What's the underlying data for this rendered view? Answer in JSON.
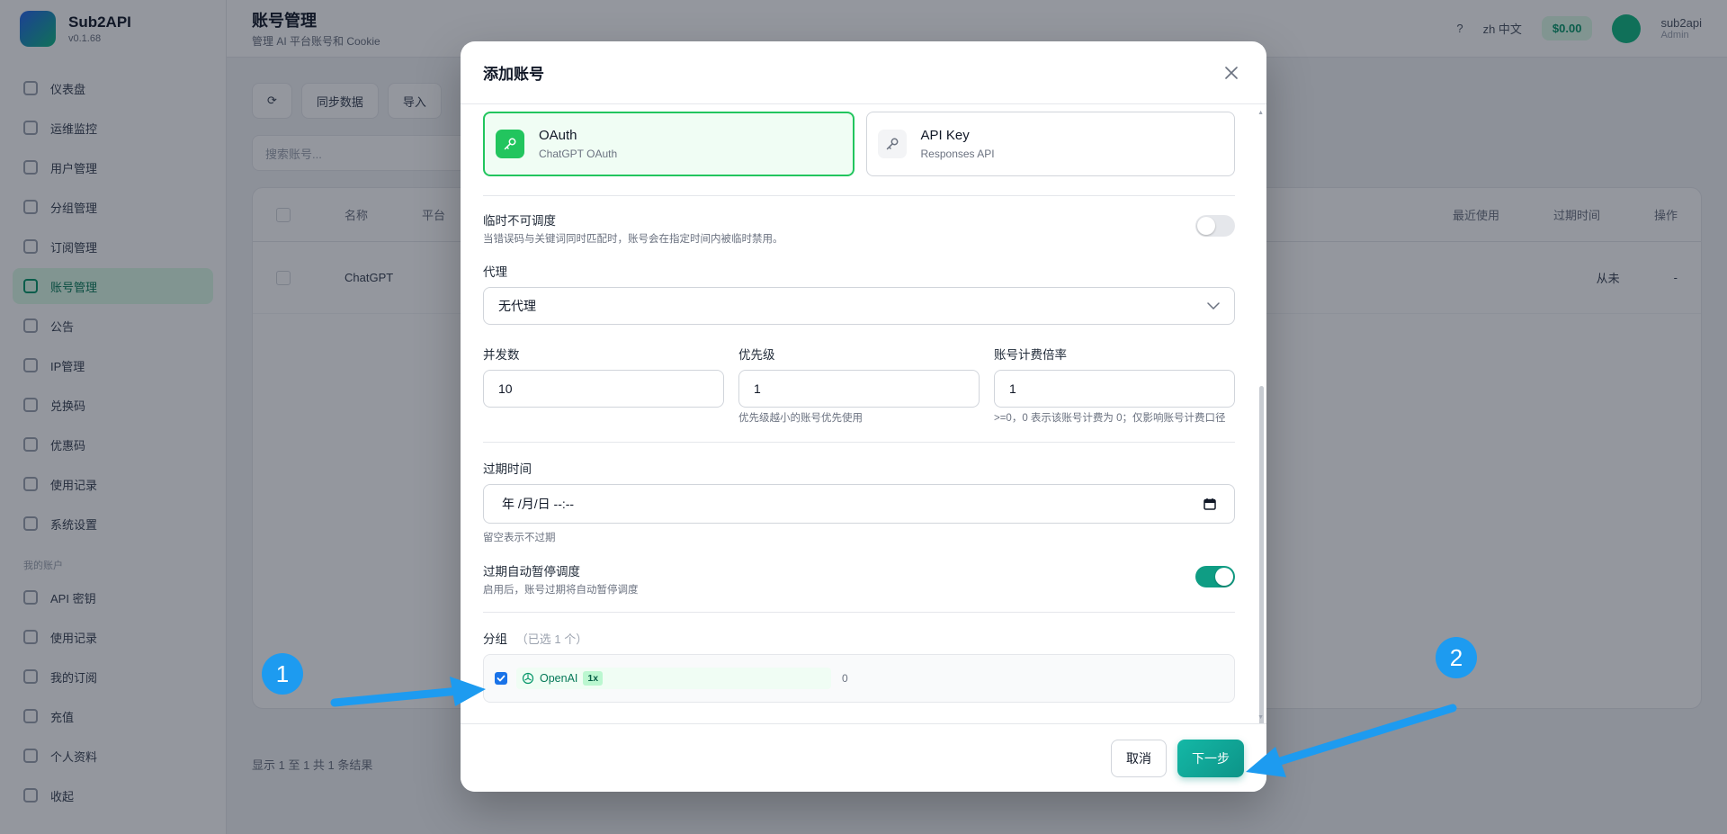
{
  "app": {
    "name": "Sub2API",
    "version": "v0.1.68"
  },
  "sidebar": {
    "items": [
      {
        "label": "仪表盘"
      },
      {
        "label": "运维监控"
      },
      {
        "label": "用户管理"
      },
      {
        "label": "分组管理"
      },
      {
        "label": "订阅管理"
      },
      {
        "label": "账号管理"
      },
      {
        "label": "公告"
      },
      {
        "label": "IP管理"
      },
      {
        "label": "兑换码"
      },
      {
        "label": "优惠码"
      },
      {
        "label": "使用记录"
      },
      {
        "label": "系统设置"
      }
    ],
    "section_label": "我的账户",
    "user_items": [
      {
        "label": "API 密钥"
      },
      {
        "label": "使用记录"
      },
      {
        "label": "我的订阅"
      },
      {
        "label": "充值"
      },
      {
        "label": "个人资料"
      }
    ],
    "collapse_label": "收起"
  },
  "topbar": {
    "title": "账号管理",
    "subtitle": "管理 AI 平台账号和 Cookie",
    "lang": "zh 中文",
    "balance": "$0.00",
    "user_name": "sub2api",
    "user_role": "Admin"
  },
  "content": {
    "toolbar": [
      "",
      "同步数据",
      "导入"
    ],
    "search_placeholder": "搜索账号...",
    "columns": [
      "名称",
      "平台",
      "最近使用",
      "过期时间",
      "操作"
    ],
    "row": {
      "name": "ChatGPT",
      "last_used": "从未",
      "expires": "-"
    },
    "pager": "显示 1 至 1 共 1 条结果"
  },
  "modal": {
    "title": "添加账号",
    "auth_types": [
      {
        "name": "OAuth",
        "desc": "ChatGPT OAuth",
        "selected": true
      },
      {
        "name": "API Key",
        "desc": "Responses API",
        "selected": false
      }
    ],
    "temp_unschedulable": {
      "label": "临时不可调度",
      "hint": "当错误码与关键词同时匹配时，账号会在指定时间内被临时禁用。",
      "enabled": false
    },
    "proxy": {
      "label": "代理",
      "value": "无代理"
    },
    "concurrency": {
      "label": "并发数",
      "value": "10"
    },
    "priority": {
      "label": "优先级",
      "value": "1",
      "hint": "优先级越小的账号优先使用"
    },
    "rate_multiplier": {
      "label": "账号计费倍率",
      "value": "1",
      "hint": ">=0，0 表示该账号计费为 0；仅影响账号计费口径"
    },
    "expiry": {
      "label": "过期时间",
      "placeholder": "年 /月/日 --:--",
      "hint": "留空表示不过期"
    },
    "auto_pause": {
      "label": "过期自动暂停调度",
      "hint": "启用后，账号过期将自动暂停调度",
      "enabled": true
    },
    "groups": {
      "label": "分组",
      "selected_count": "（已选 1 个）",
      "items": [
        {
          "name": "OpenAI",
          "rate": "1x",
          "count": "0",
          "checked": true
        }
      ]
    },
    "cancel_label": "取消",
    "next_label": "下一步"
  },
  "annotations": {
    "badge1": "1",
    "badge2": "2"
  },
  "colors": {
    "accent": "#0d9488",
    "selected_border": "#22c55e",
    "annotation": "#1d9bf0"
  }
}
